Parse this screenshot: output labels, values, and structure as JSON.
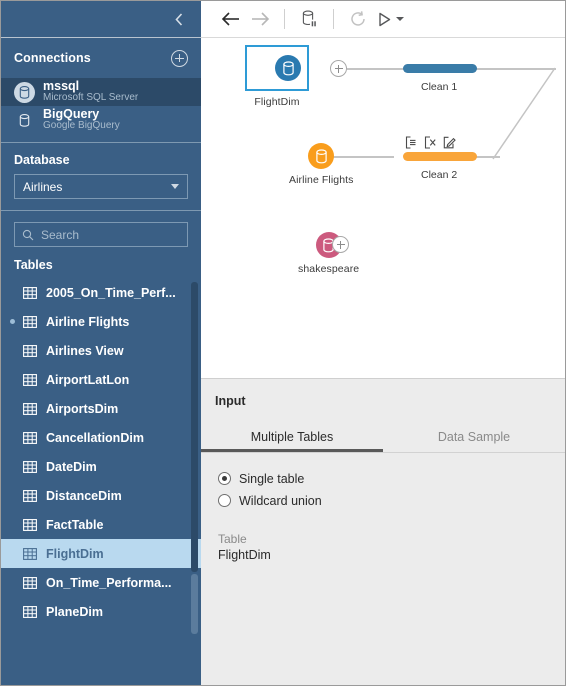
{
  "sidebar": {
    "collapse_icon": "chevron-left-icon",
    "connections": {
      "header": "Connections",
      "add_icon": "plus-circle-icon",
      "items": [
        {
          "name": "mssql",
          "subtitle": "Microsoft SQL Server",
          "icon": "database-icon",
          "selected": true
        },
        {
          "name": "BigQuery",
          "subtitle": "Google BigQuery",
          "icon": "database-icon",
          "selected": false
        }
      ]
    },
    "database": {
      "label": "Database",
      "selected": "Airlines",
      "caret_icon": "chevron-down-icon"
    },
    "search": {
      "placeholder": "Search",
      "value": "",
      "icon": "search-icon"
    },
    "tables": {
      "label": "Tables",
      "items": [
        {
          "name": "2005_On_Time_Perf...",
          "selected": false,
          "marked": false
        },
        {
          "name": "Airline Flights",
          "selected": false,
          "marked": true
        },
        {
          "name": "Airlines View",
          "selected": false,
          "marked": false
        },
        {
          "name": "AirportLatLon",
          "selected": false,
          "marked": false
        },
        {
          "name": "AirportsDim",
          "selected": false,
          "marked": false
        },
        {
          "name": "CancellationDim",
          "selected": false,
          "marked": false
        },
        {
          "name": "DateDim",
          "selected": false,
          "marked": false
        },
        {
          "name": "DistanceDim",
          "selected": false,
          "marked": false
        },
        {
          "name": "FactTable",
          "selected": false,
          "marked": false
        },
        {
          "name": "FlightDim",
          "selected": true,
          "marked": false
        },
        {
          "name": "On_Time_Performa...",
          "selected": false,
          "marked": false
        },
        {
          "name": "PlaneDim",
          "selected": false,
          "marked": false
        }
      ]
    }
  },
  "toolbar": {
    "back_icon": "arrow-left-icon",
    "forward_icon": "arrow-right-icon",
    "pause_data_icon": "database-pause-icon",
    "refresh_icon": "refresh-icon",
    "run_icon": "play-icon",
    "run_caret_icon": "chevron-down-icon"
  },
  "flow": {
    "nodes": [
      {
        "label": "FlightDim",
        "color": "#2a7ab0",
        "selected": true,
        "has_plus": true
      },
      {
        "label": "Airline Flights",
        "color": "#f99d1c",
        "selected": false,
        "has_plus": false
      },
      {
        "label": "shakespeare",
        "color": "#cc5a7e",
        "selected": false,
        "has_plus": true
      }
    ],
    "steps": [
      {
        "label": "Clean 1",
        "color": "#3a7ca8",
        "actions": []
      },
      {
        "label": "Clean 2",
        "color": "#f9a53a",
        "actions": [
          "add-step-icon",
          "remove-step-icon",
          "edit-step-icon"
        ]
      }
    ]
  },
  "input_panel": {
    "title": "Input",
    "tabs": [
      {
        "label": "Multiple Tables",
        "active": true
      },
      {
        "label": "Data Sample",
        "active": false
      }
    ],
    "options": [
      {
        "label": "Single table",
        "checked": true
      },
      {
        "label": "Wildcard union",
        "checked": false
      }
    ],
    "table_field": {
      "label": "Table",
      "value": "FlightDim"
    }
  }
}
